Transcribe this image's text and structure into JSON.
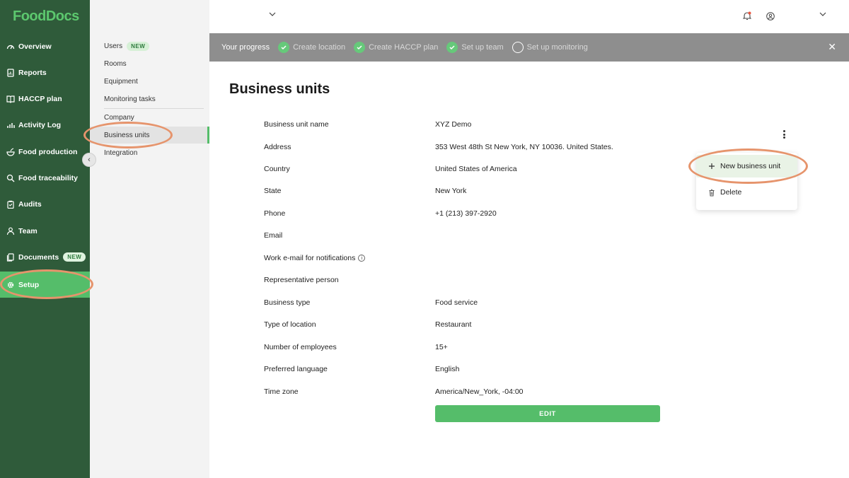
{
  "app": {
    "logo": "FoodDocs"
  },
  "nav": {
    "items": [
      {
        "label": "Overview",
        "icon": "gauge-icon"
      },
      {
        "label": "Reports",
        "icon": "report-icon"
      },
      {
        "label": "HACCP plan",
        "icon": "book-icon"
      },
      {
        "label": "Activity Log",
        "icon": "bars-icon"
      },
      {
        "label": "Food production",
        "icon": "bowl-icon"
      },
      {
        "label": "Food traceability",
        "icon": "search-icon"
      },
      {
        "label": "Audits",
        "icon": "clipboard-icon"
      },
      {
        "label": "Team",
        "icon": "person-icon"
      },
      {
        "label": "Documents",
        "icon": "documents-icon",
        "badge": "NEW"
      },
      {
        "label": "Setup",
        "icon": "gear-icon",
        "active": true
      }
    ]
  },
  "subnav": {
    "items": [
      {
        "label": "Users",
        "badge": "NEW"
      },
      {
        "label": "Rooms"
      },
      {
        "label": "Equipment"
      },
      {
        "label": "Monitoring tasks"
      },
      {
        "label": "Company"
      },
      {
        "label": "Business units",
        "active": true
      },
      {
        "label": "Integration"
      }
    ]
  },
  "progress": {
    "lead": "Your progress",
    "steps": [
      {
        "label": "Create location",
        "done": true
      },
      {
        "label": "Create HACCP plan",
        "done": true
      },
      {
        "label": "Set up team",
        "done": true
      },
      {
        "label": "Set up monitoring",
        "done": false
      }
    ],
    "close": "✕"
  },
  "main": {
    "title": "Business units",
    "fields": [
      {
        "label": "Business unit name",
        "value": "XYZ Demo"
      },
      {
        "label": "Address",
        "value": "353 West 48th St New York, NY 10036. United States."
      },
      {
        "label": "Country",
        "value": "United States of America"
      },
      {
        "label": "State",
        "value": "New York"
      },
      {
        "label": "Phone",
        "value": "+1 (213) 397-2920"
      },
      {
        "label": "Email",
        "value": ""
      },
      {
        "label": "Work e-mail for notifications",
        "value": "",
        "info": "i"
      },
      {
        "label": "Representative person",
        "value": ""
      },
      {
        "label": "Business type",
        "value": "Food service"
      },
      {
        "label": "Type of location",
        "value": "Restaurant"
      },
      {
        "label": "Number of employees",
        "value": "15+"
      },
      {
        "label": "Preferred language",
        "value": "English"
      },
      {
        "label": "Time zone",
        "value": "America/New_York, -04:00"
      }
    ],
    "edit_label": "EDIT"
  },
  "menu": {
    "new_label": "New business unit",
    "delete_label": "Delete"
  },
  "colors": {
    "nav_bg": "#2f5b3a",
    "accent": "#55bd6a",
    "progress_bg": "#8e8e8e",
    "annotation": "#e6946c"
  }
}
